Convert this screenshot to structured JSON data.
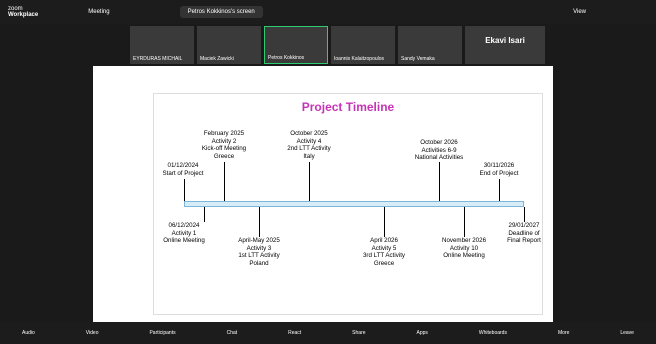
{
  "app": {
    "brand_line1": "zoom",
    "brand_line2": "Workplace",
    "meeting": "Meeting",
    "screen_share": "Petros Kokkinos's screen",
    "view": "View"
  },
  "participants": [
    "EYRDURAS MICHAIL",
    "Maciek Zawicki",
    "Petros Kokkinos",
    "Ioannis Kalaitzopoulos",
    "Sandy Vemaka",
    "Ekavi Isari"
  ],
  "slide": {
    "title": "Project Timeline",
    "events": [
      {
        "date": "01/12/2024",
        "text": "Start of Project"
      },
      {
        "date": "February 2025",
        "text": "Activity 2\nKick-off Meeting\nGreece"
      },
      {
        "date": "October 2025",
        "text": "Activity 4\n2nd LTT Activity\nItaly"
      },
      {
        "date": "October 2026",
        "text": "Activities 6-9\nNational Activities"
      },
      {
        "date": "30/11/2026",
        "text": "End of Project"
      },
      {
        "date": "06/12/2024",
        "text": "Activity 1\nOnline Meeting"
      },
      {
        "date": "April-May 2025",
        "text": "Activity 3\n1st LTT Activity\nPoland"
      },
      {
        "date": "April 2026",
        "text": "Activity 5\n3rd LTT Activity\nGreece"
      },
      {
        "date": "November 2026",
        "text": "Activity 10\nOnline Meeting"
      },
      {
        "date": "29/01/2027",
        "text": "Deadline of\nFinal Report"
      }
    ]
  },
  "bottom": [
    "Audio",
    "Video",
    "Participants",
    "Chat",
    "React",
    "Share",
    "Apps",
    "Whiteboards",
    "More",
    "Leave"
  ]
}
